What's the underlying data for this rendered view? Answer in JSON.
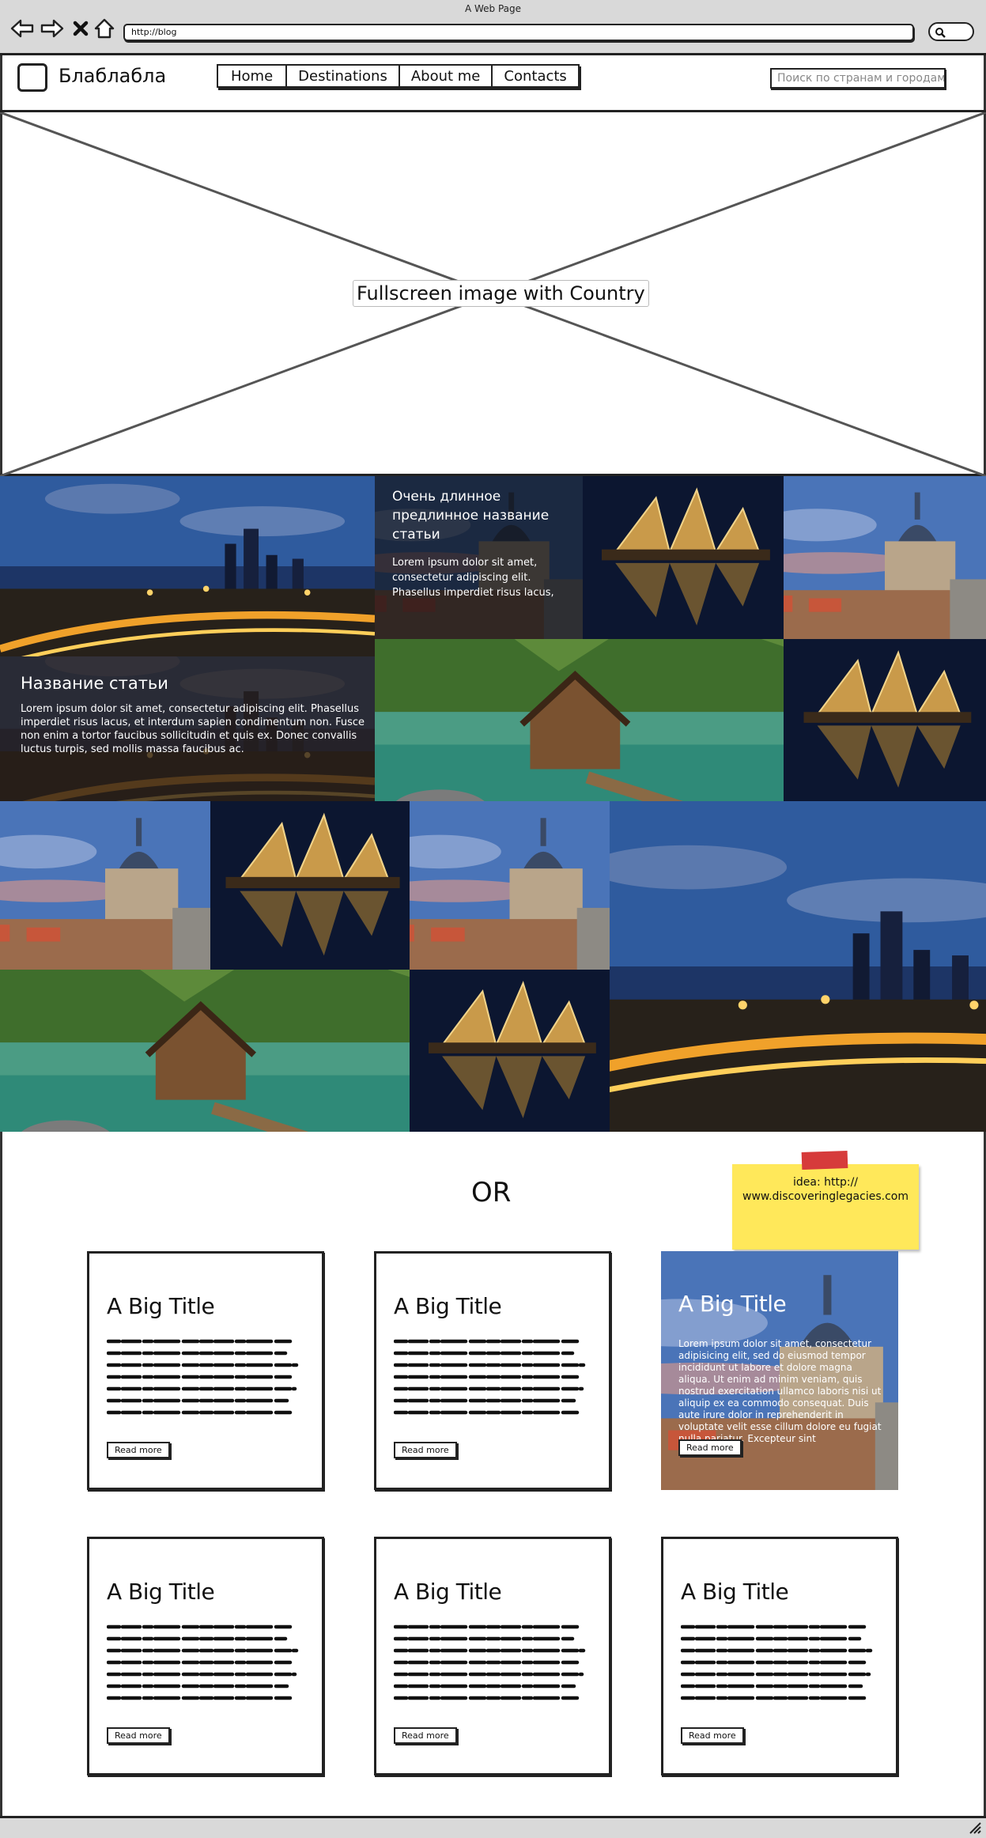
{
  "window": {
    "title": "A Web Page",
    "url": "http://blog"
  },
  "site": {
    "name": "Блаблабла"
  },
  "nav": {
    "items": [
      "Home",
      "Destinations",
      "About me",
      "Contacts"
    ],
    "active": "Home"
  },
  "search": {
    "placeholder": "Поиск по странам и городам"
  },
  "hero": {
    "label": "Fullscreen image with Country"
  },
  "gallery": {
    "feature_small": {
      "title": "Очень длинное предлинное название статьи",
      "text": "Lorem ipsum dolor sit amet, consectetur adipiscing elit. Phasellus imperdiet risus lacus,"
    },
    "feature_large": {
      "title": "Название статьи",
      "text": "Lorem ipsum dolor sit amet, consectetur adipiscing elit. Phasellus imperdiet risus lacus, et interdum sapien condimentum non. Fusce non enim a tortor faucibus sollicitudin et quis ex. Donec convallis luctus turpis, sed mollis massa faucibus ac."
    }
  },
  "divider": {
    "label": "OR"
  },
  "note": {
    "text": "idea: http://\nwww.discoveringlegacies.com"
  },
  "cards": [
    {
      "title": "A Big Title",
      "button": "Read more"
    },
    {
      "title": "A Big Title",
      "button": "Read more"
    },
    {
      "title": "A Big Title",
      "button": "Read more",
      "text": "Lorem ipsum dolor sit amet, consectetur adipisicing elit, sed do eiusmod tempor incididunt ut labore et dolore magna aliqua. Ut enim ad minim veniam, quis nostrud exercitation ullamco laboris nisi ut aliquip ex ea commodo consequat. Duis aute irure dolor in reprehenderit in voluptate velit esse cillum dolore eu fugiat nulla pariatur. Excepteur sint"
    },
    {
      "title": "A Big Title",
      "button": "Read more"
    },
    {
      "title": "A Big Title",
      "button": "Read more"
    },
    {
      "title": "A Big Title",
      "button": "Read more"
    }
  ],
  "colors": {
    "window_chrome": "#d9d9d9",
    "sticky_note": "#ffe85a",
    "tape": "#d63b3b",
    "ink": "#222222"
  },
  "icons": [
    "back-icon",
    "forward-icon",
    "close-icon",
    "home-icon",
    "search-icon",
    "resize-grip-icon"
  ]
}
